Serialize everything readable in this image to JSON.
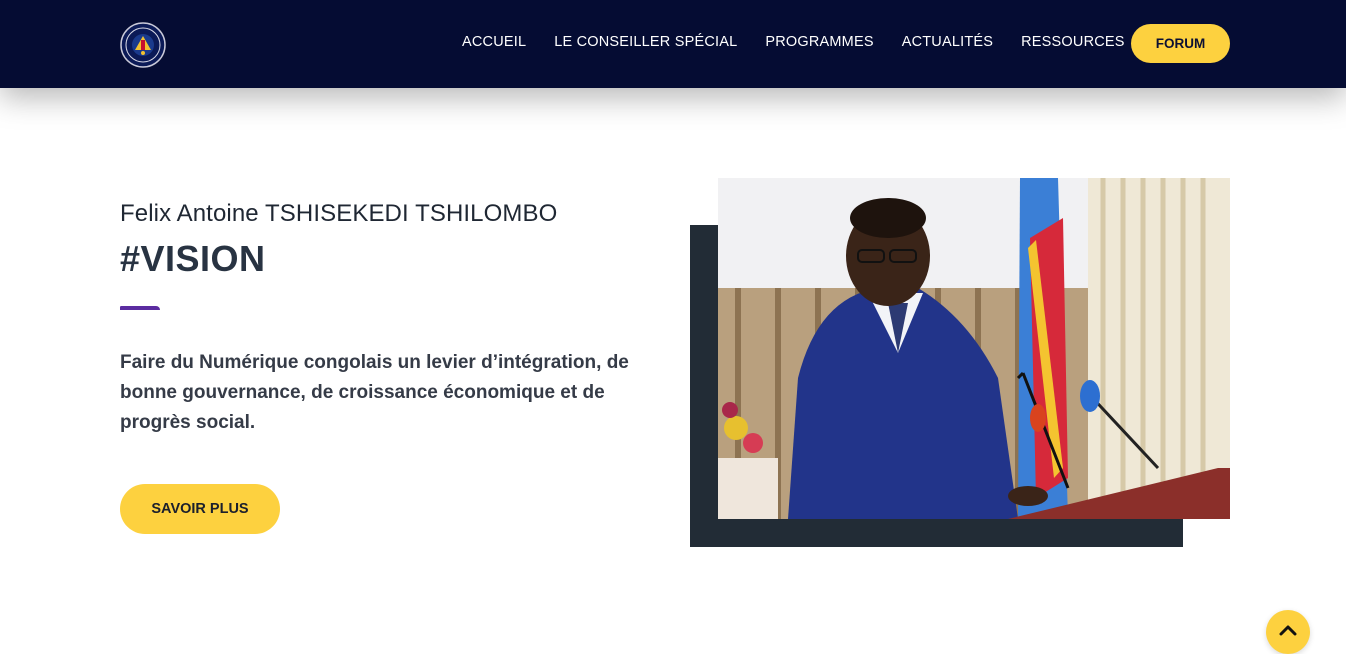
{
  "header": {
    "logo_icon": "coat-of-arms-seal-icon",
    "nav": [
      {
        "label": "ACCUEIL"
      },
      {
        "label": "LE CONSEILLER SPÉCIAL"
      },
      {
        "label": "PROGRAMMES"
      },
      {
        "label": "ACTUALITÉS"
      },
      {
        "label": "RESSOURCES"
      }
    ],
    "forum_label": "FORUM"
  },
  "hero": {
    "subtitle": "Felix Antoine TSHISEKEDI TSHILOMBO",
    "title": "#VISION",
    "description": "Faire du Numérique congolais un levier d’intégration, de bonne gouvernance, de croissance économique et de progrès social.",
    "cta_label": "SAVOIR PLUS"
  },
  "scroll_top_icon": "chevron-up-icon",
  "colors": {
    "header_bg": "#050c33",
    "accent_yellow": "#fdd13f",
    "accent_purple": "#5b2ca0",
    "backdrop_dark": "#222c36"
  }
}
